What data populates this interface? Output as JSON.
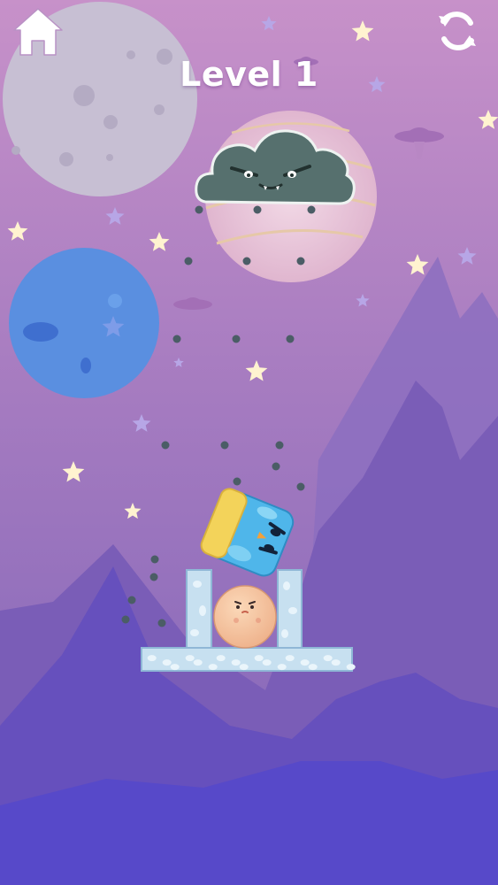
{
  "level": {
    "title": "Level 1",
    "number": 1
  },
  "hud": {
    "home_icon": "home-icon",
    "restart_icon": "restart-icon"
  },
  "game": {
    "enemy": "angry-storm-cloud",
    "characters": [
      "blue-bird-block",
      "peach-ball-character"
    ],
    "platform": "ice-platform",
    "pillars": 2
  },
  "colors": {
    "sky_top": "#c48fca",
    "sky_bottom": "#7a5bb5",
    "mountain_far": "#8a6dbd",
    "mountain_near": "#5a4bc7",
    "cloud": "#55706f",
    "bird": "#4fb6ea",
    "ball": "#f6c7a1",
    "ice": "#c8e2f2"
  }
}
